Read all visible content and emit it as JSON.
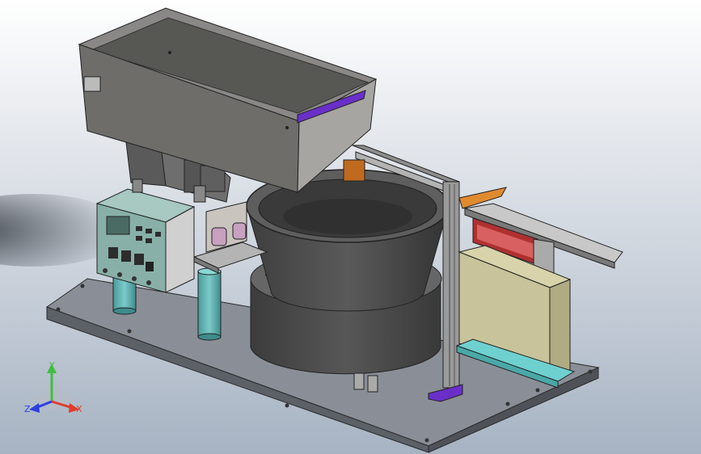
{
  "viewport": {
    "background_top": "#ffffff",
    "background_bottom": "#a7b3c3"
  },
  "triad": {
    "x_label": "X",
    "y_label": "Y",
    "z_label": "Z",
    "x_color": "#e23b2b",
    "y_color": "#3fbf3f",
    "z_color": "#2b3fe2"
  },
  "colors": {
    "base_plate": "#7c8189",
    "hopper": "#6b6b68",
    "bowl": "#4d4d4d",
    "controller": "#88b0a8",
    "accent_purple": "#6a2fc9",
    "accent_orange": "#c06a20",
    "accent_pink": "#c8a0c0",
    "column_cyan": "#5aa9a9",
    "tray": "#c8c39a",
    "rail_cyan": "#6fd0d0"
  }
}
